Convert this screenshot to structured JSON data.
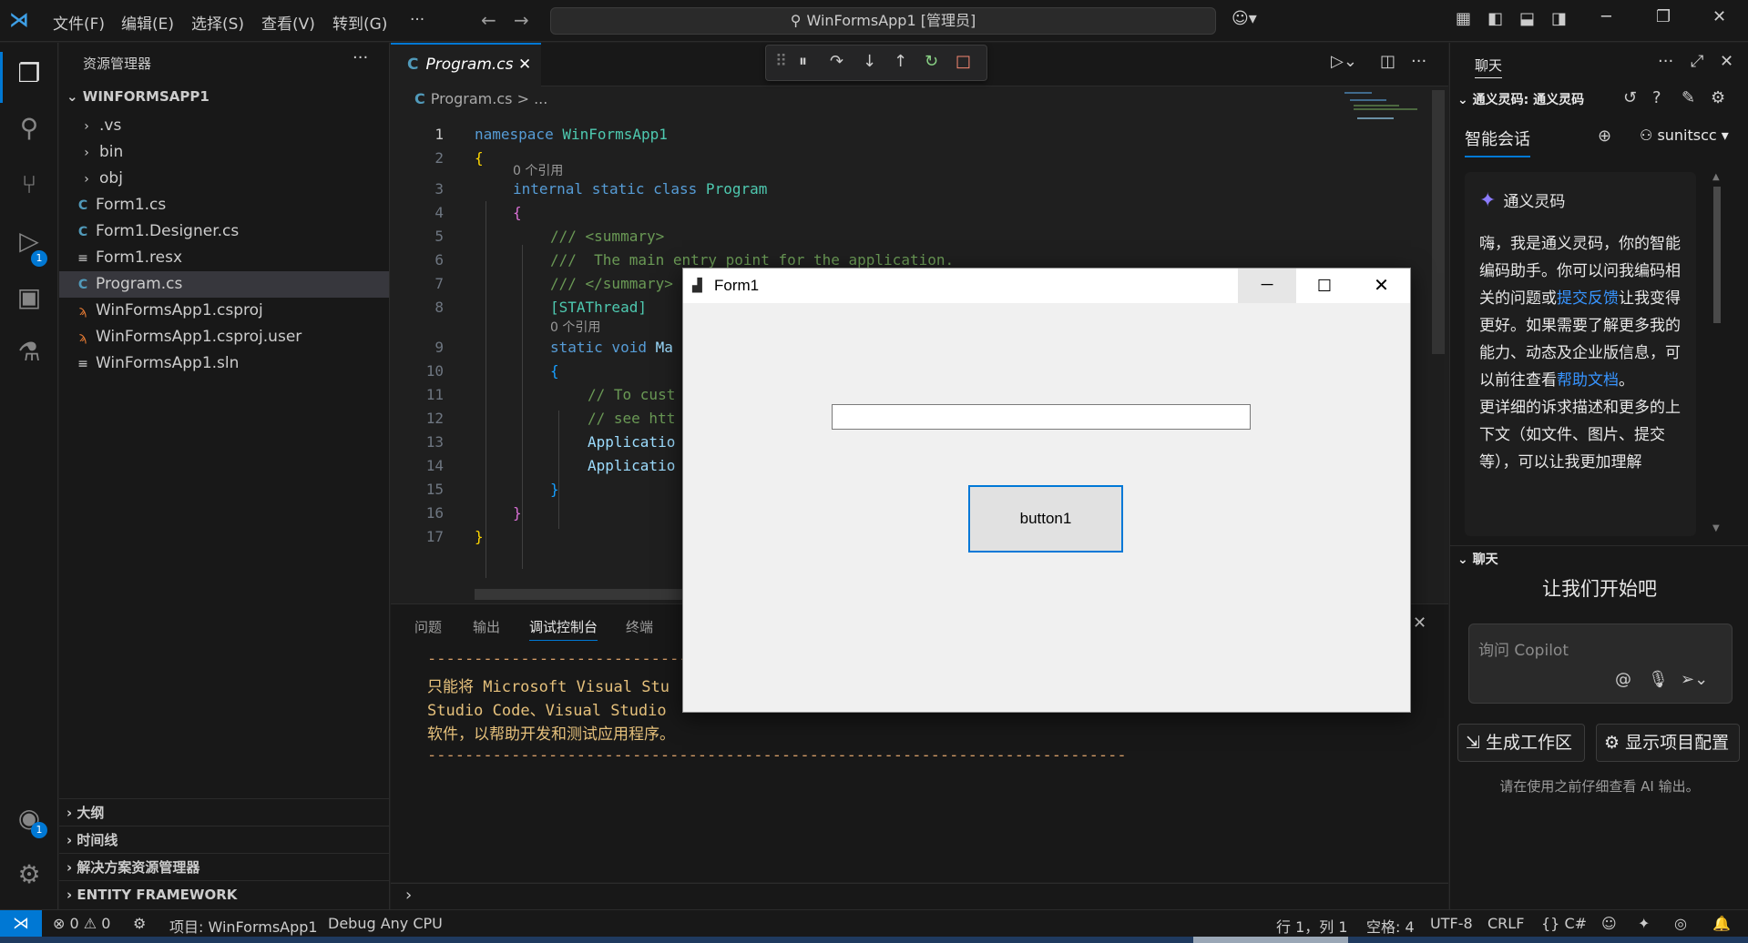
{
  "titlebar": {
    "menus": [
      "文件(F)",
      "编辑(E)",
      "选择(S)",
      "查看(V)",
      "转到(G)",
      "···"
    ],
    "search": "WinFormsApp1 [管理员]"
  },
  "activity": {
    "debug_badge": "1",
    "account_badge": "1"
  },
  "sidebar": {
    "title": "资源管理器",
    "more": "···",
    "folder": "WINFORMSAPP1",
    "items": [
      {
        "name": ".vs",
        "icon": "chevron-right-icon"
      },
      {
        "name": "bin",
        "icon": "chevron-right-icon"
      },
      {
        "name": "obj",
        "icon": "chevron-right-icon"
      },
      {
        "name": "Form1.cs",
        "icon": "csharp-icon"
      },
      {
        "name": "Form1.Designer.cs",
        "icon": "csharp-icon"
      },
      {
        "name": "Form1.resx",
        "icon": "lines-icon"
      },
      {
        "name": "Program.cs",
        "icon": "csharp-icon"
      },
      {
        "name": "WinFormsApp1.csproj",
        "icon": "rss-icon"
      },
      {
        "name": "WinFormsApp1.csproj.user",
        "icon": "rss-icon"
      },
      {
        "name": "WinFormsApp1.sln",
        "icon": "lines-icon"
      }
    ],
    "sections": [
      "大纲",
      "时间线",
      "解决方案资源管理器",
      "ENTITY FRAMEWORK"
    ]
  },
  "editor": {
    "tab": "Program.cs",
    "breadcrumb_file": "Program.cs",
    "breadcrumb_rest": "> ...",
    "codelens": "0 个引用",
    "line_numbers": [
      "1",
      "2",
      "3",
      "4",
      "5",
      "6",
      "7",
      "8",
      "9",
      "10",
      "11",
      "12",
      "13",
      "14",
      "15",
      "16",
      "17"
    ],
    "code": {
      "l1_kw": "namespace",
      "l1_name": " WinFormsApp1",
      "l2": "{",
      "l3_kw": "internal static class",
      "l3_name": " Program",
      "l4": "{",
      "l5": "/// <summary>",
      "l6": "///  The main entry point for the application.",
      "l7": "/// </summary>",
      "l8": "[STAThread]",
      "l9_kw": "static void",
      "l9_name": " Ma",
      "l10": "{",
      "l11": "// To cust",
      "l12": "// see htt",
      "l13": "Applicatio",
      "l14": "Applicatio",
      "l15": "}",
      "l16": "}",
      "l17": "}"
    }
  },
  "panel": {
    "tabs": [
      "问题",
      "输出",
      "调试控制台",
      "终端"
    ],
    "lines": [
      "-------------------------------",
      "只能将 Microsoft Visual Stu",
      "Studio Code、Visual Studio ",
      "软件，以帮助开发和测试应用程序。",
      "---------------------------------------------------------------------------"
    ]
  },
  "chat": {
    "title": "聊天",
    "subheader": "通义灵码: 通义灵码",
    "smart_tab": "智能会话",
    "user": "sunitscc",
    "assistant_name": "通义灵码",
    "msg1": "嗨，我是通义灵码，你的智能编码助手。你可以问我编码相关的问题或",
    "msg1_link": "提交反馈",
    "msg2": "让我变得更好。如果需要了解更多我的能力、动态及企业版信息，可以前往查看",
    "msg2_link": "帮助文档",
    "msg3": "。",
    "msg4": "更详细的诉求描述和更多的上下文（如文件、图片、提交等），可以让我更加理解",
    "section": "聊天",
    "lets_start": "让我们开始吧",
    "input_placeholder": "询问 Copilot",
    "btn_workspace": "生成工作区",
    "btn_config": "显示项目配置",
    "notice": "请在使用之前仔细查看 AI 输出。"
  },
  "status": {
    "errors": "0",
    "warnings": "0",
    "project": "项目: WinFormsApp1",
    "config": "Debug Any CPU",
    "position": "行 1，列 1",
    "spaces": "空格: 4",
    "encoding": "UTF-8",
    "eol": "CRLF",
    "language": "C#"
  },
  "form1": {
    "title": "Form1",
    "textbox_value": "",
    "button": "button1"
  },
  "colors": {
    "accent": "#0078d4",
    "form_border": "#0078d7"
  }
}
